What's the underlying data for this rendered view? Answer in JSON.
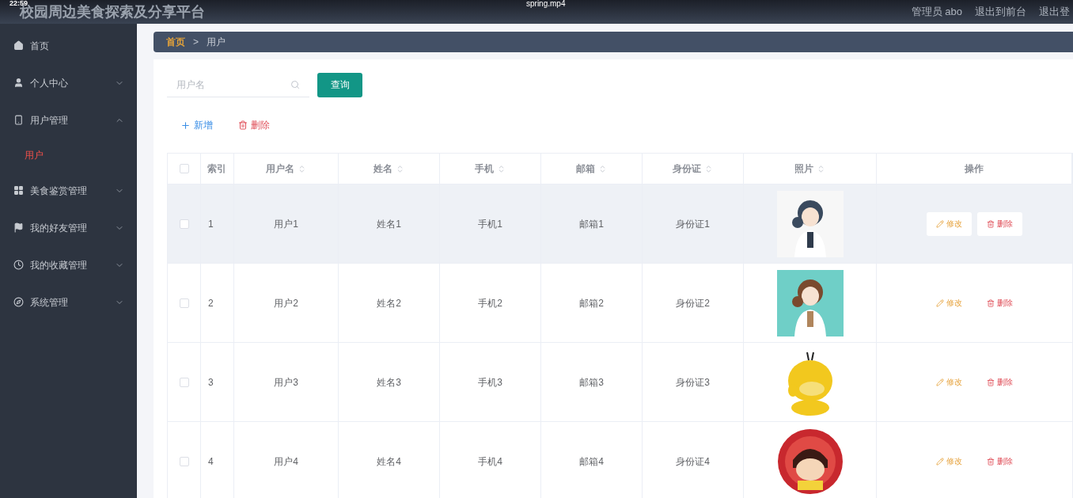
{
  "recording": {
    "time": "22:59",
    "file": "spring.mp4"
  },
  "header": {
    "title": "校园周边美食探索及分享平台",
    "user": "管理员 abo",
    "links": [
      "退出到前台",
      "退出登"
    ]
  },
  "sidebar": {
    "items": [
      {
        "label": "首页",
        "kind": "link"
      },
      {
        "label": "个人中心",
        "kind": "menu",
        "expanded": false
      },
      {
        "label": "用户管理",
        "kind": "menu",
        "expanded": true,
        "children": [
          {
            "label": "用户",
            "selected": true
          }
        ]
      },
      {
        "label": "美食鉴赏管理",
        "kind": "menu",
        "expanded": false
      },
      {
        "label": "我的好友管理",
        "kind": "menu",
        "expanded": false
      },
      {
        "label": "我的收藏管理",
        "kind": "menu",
        "expanded": false
      },
      {
        "label": "系统管理",
        "kind": "menu",
        "expanded": false
      }
    ]
  },
  "breadcrumb": {
    "items": [
      "首页",
      "用户"
    ],
    "separator": ">"
  },
  "search": {
    "placeholder": "用户名",
    "button": "查询"
  },
  "actions": {
    "add": "新增",
    "delete": "删除"
  },
  "table": {
    "select_all_checked": false,
    "columns": [
      {
        "label": "索引",
        "sortable": false
      },
      {
        "label": "用户名",
        "sortable": true
      },
      {
        "label": "姓名",
        "sortable": true
      },
      {
        "label": "手机",
        "sortable": true
      },
      {
        "label": "邮箱",
        "sortable": true
      },
      {
        "label": "身份证",
        "sortable": true
      },
      {
        "label": "照片",
        "sortable": true
      },
      {
        "label": "操作",
        "sortable": false
      }
    ],
    "rows": [
      {
        "index": "1",
        "username": "用户1",
        "name": "姓名1",
        "phone": "手机1",
        "email": "邮箱1",
        "id_card": "身份证1",
        "edit": "修改",
        "delete": "删除",
        "checked": false,
        "highlighted": true
      },
      {
        "index": "2",
        "username": "用户2",
        "name": "姓名2",
        "phone": "手机2",
        "email": "邮箱2",
        "id_card": "身份证2",
        "edit": "修改",
        "delete": "删除",
        "checked": false,
        "highlighted": false
      },
      {
        "index": "3",
        "username": "用户3",
        "name": "姓名3",
        "phone": "手机3",
        "email": "邮箱3",
        "id_card": "身份证3",
        "edit": "修改",
        "delete": "删除",
        "checked": false,
        "highlighted": false
      },
      {
        "index": "4",
        "username": "用户4",
        "name": "姓名4",
        "phone": "手机4",
        "email": "邮箱4",
        "id_card": "身份证4",
        "edit": "修改",
        "delete": "删除",
        "checked": false,
        "highlighted": false
      }
    ]
  }
}
